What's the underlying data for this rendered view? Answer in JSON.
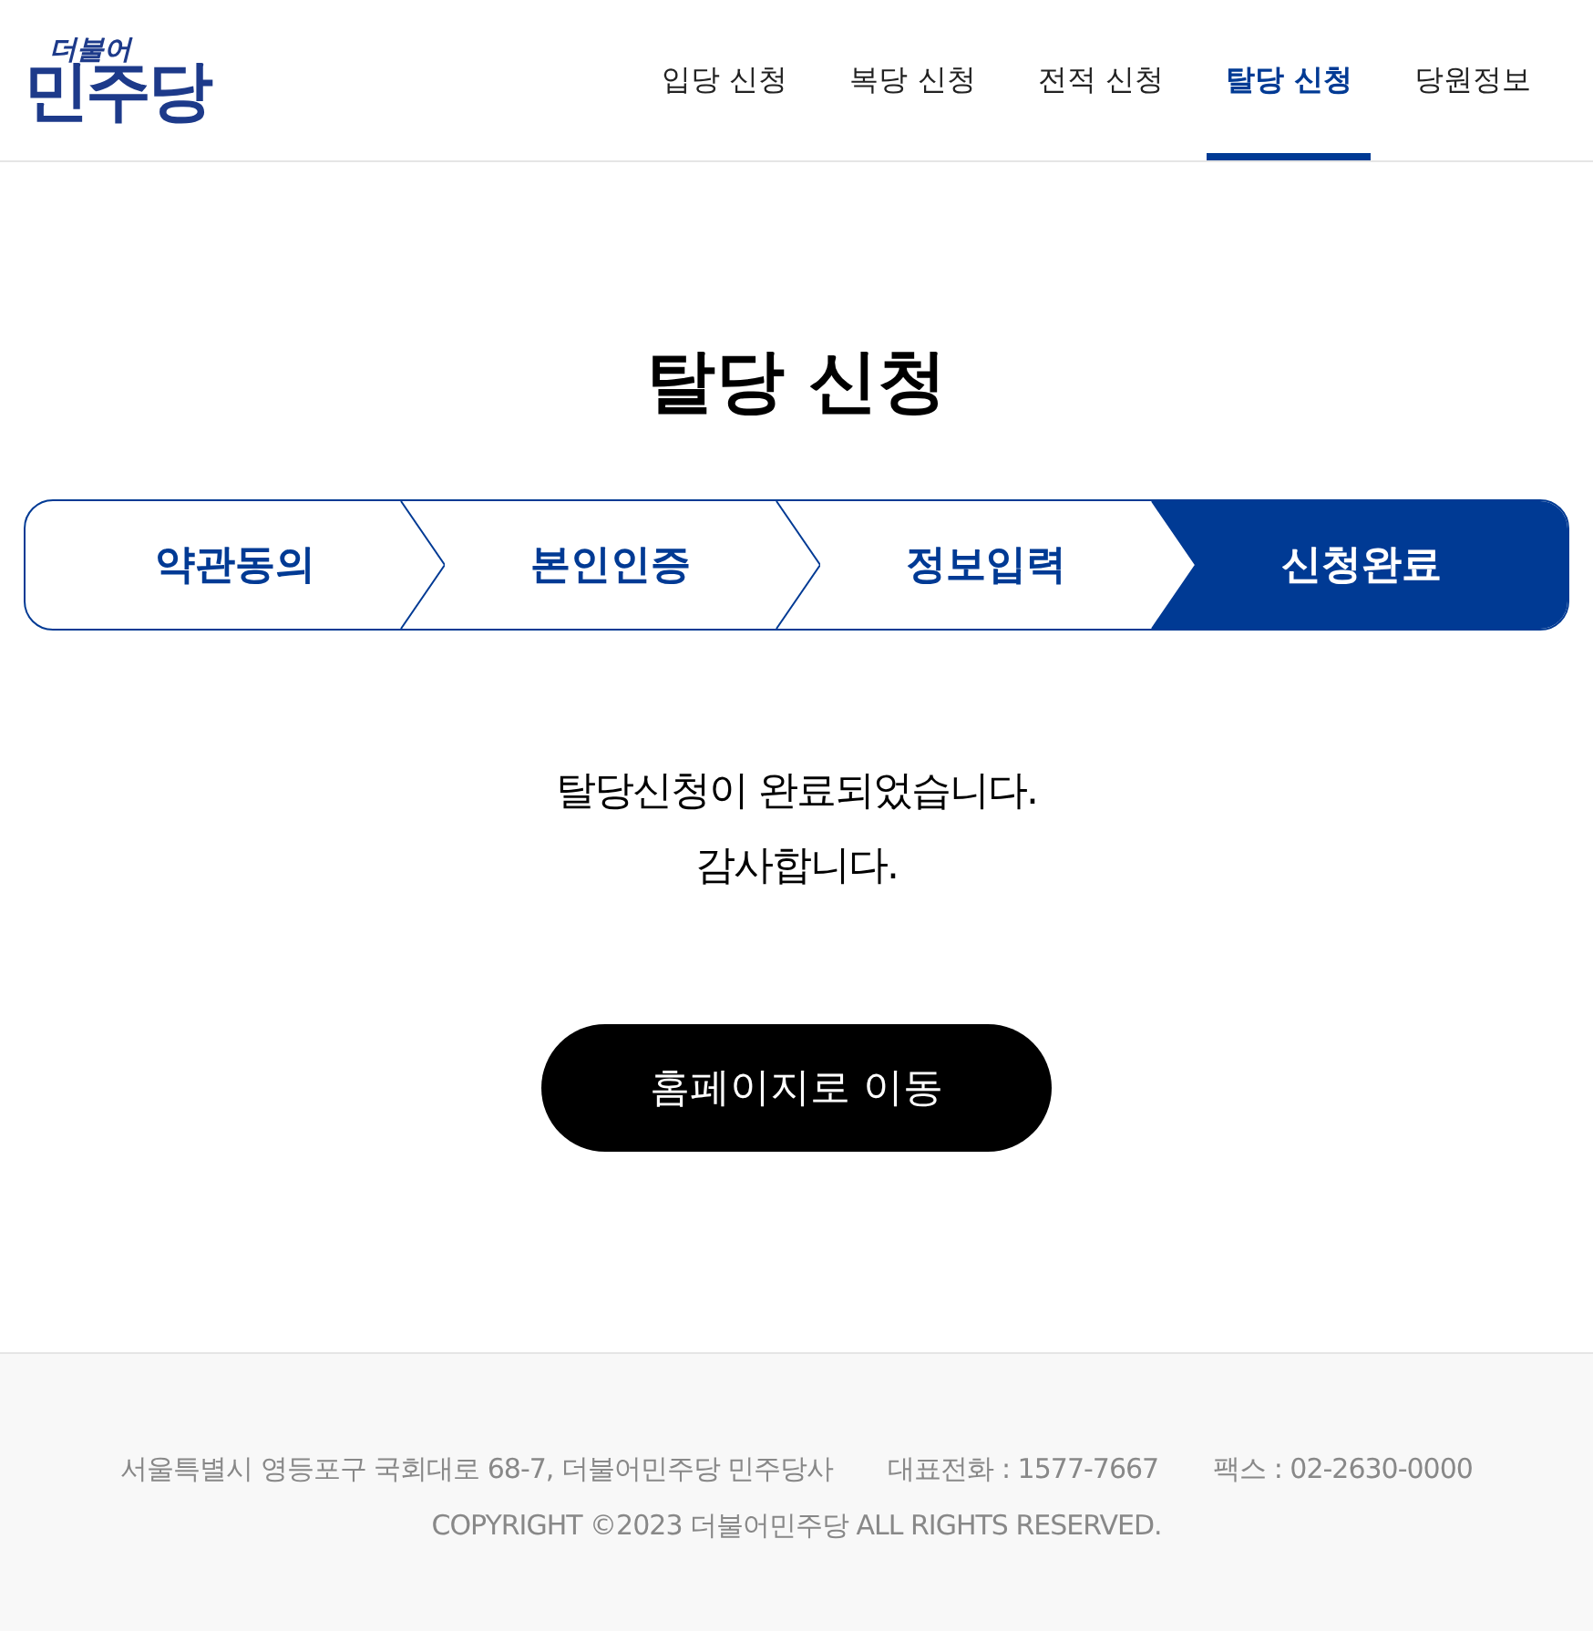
{
  "logo": {
    "small": "더불어",
    "main": "민주당"
  },
  "nav": [
    {
      "label": "입당 신청",
      "selected": false
    },
    {
      "label": "복당 신청",
      "selected": false
    },
    {
      "label": "전적 신청",
      "selected": false
    },
    {
      "label": "탈당 신청",
      "selected": true
    },
    {
      "label": "당원정보",
      "selected": false
    }
  ],
  "title": "탈당 신청",
  "steps": [
    {
      "label": "약관동의",
      "selected": false
    },
    {
      "label": "본인인증",
      "selected": false
    },
    {
      "label": "정보입력",
      "selected": false
    },
    {
      "label": "신청완료",
      "selected": true
    }
  ],
  "message": [
    "탈당신청이 완료되었습니다.",
    "감사합니다."
  ],
  "home_button": "홈페이지로 이동",
  "footer": {
    "address": "서울특별시 영등포구 국회대로 68-7, 더불어민주당 민주당사",
    "phone": "대표전화 : 1577-7667",
    "fax": "팩스 : 02-2630-0000",
    "copyright": "COPYRIGHT ©2023 더불어민주당 ALL RIGHTS RESERVED."
  }
}
